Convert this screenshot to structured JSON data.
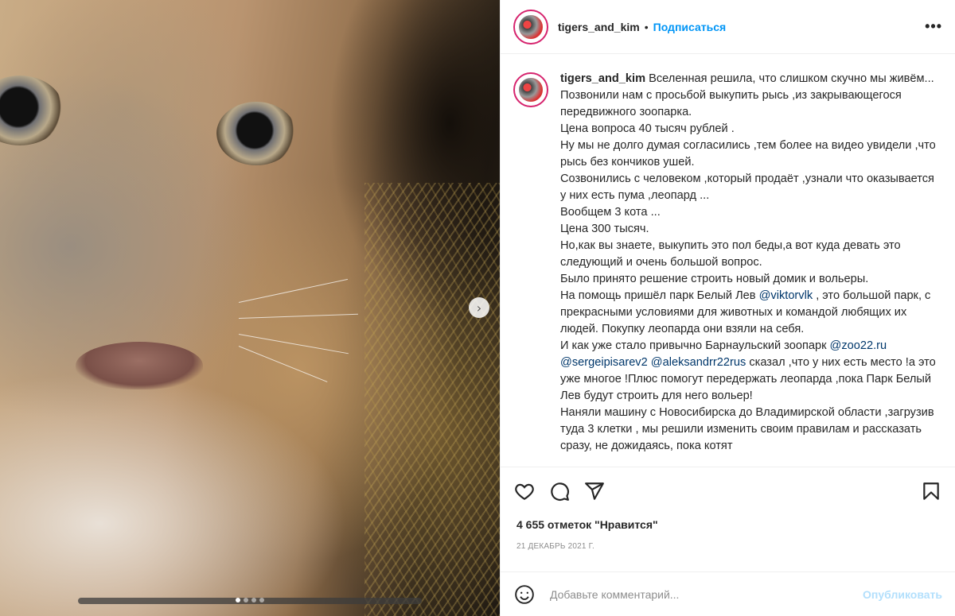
{
  "post": {
    "username": "tigers_and_kim",
    "separator": "•",
    "follow_label": "Подписаться",
    "more_label": "•••",
    "likes_text": "4 655 отметок \"Нравится\"",
    "date": "21 декабрь 2021 г.",
    "carousel": {
      "slide_count": 4,
      "active_index": 0
    }
  },
  "caption": {
    "username": "tigers_and_kim",
    "first_text": "Вселенная решила, что слишком скучно мы живём...",
    "lines": [
      "Позвонили нам с просьбой выкупить рысь ,из закрывающегося передвижного зоопарка.",
      "Цена вопроса 40 тысяч рублей .",
      "Ну мы не долго думая согласились ,тем более на видео увидели ,что рысь без кончиков ушей.",
      "Созвонились с человеком ,который продаёт ,узнали что оказывается у них есть пума ,леопард ...",
      "Вообщем 3 кота ...",
      "Цена 300 тысяч.",
      "Но,как вы знаете, выкупить это пол беды,а вот куда девать это следующий и очень большой вопрос.",
      "Было принято решение строить новый домик и вольеры."
    ],
    "park_line": {
      "before": "На помощь пришёл парк Белый Лев ",
      "mention": "@viktorvlk",
      "after": " , это большой парк, с прекрасными условиями для животных и командой любящих их людей. Покупку леопарда они взяли на себя."
    },
    "zoo_line": {
      "before": "И как уже стало привычно Барнаульский зоопарк ",
      "mention1": "@zoo22.ru",
      "mention2": "@sergeipisarev2",
      "mention3": "@aleksandrr22rus",
      "after": " сказал ,что у них есть место !а это уже многое !Плюс помогут передержать леопарда ,пока Парк Белый Лев будут строить для него вольер!"
    },
    "tail_lines": [
      "Наняли машину с Новосибирска до Владимирской области ,загрузив туда 3 клетки , мы решили изменить своим правилам и рассказать сразу, не дожидаясь, пока котят"
    ]
  },
  "actions": {
    "like_icon": "heart-icon",
    "comment_icon": "comment-icon",
    "share_icon": "share-icon",
    "save_icon": "bookmark-icon"
  },
  "comment": {
    "placeholder": "Добавьте комментарий...",
    "publish_label": "Опубликовать",
    "emoji_icon": "emoji-icon"
  },
  "colors": {
    "accent": "#0095f6",
    "publish_disabled": "#b2dffc",
    "mention": "#00376b",
    "story_ring": "#d6246e"
  }
}
